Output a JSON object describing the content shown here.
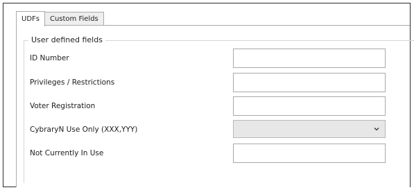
{
  "tabs": [
    {
      "label": "UDFs",
      "active": true
    },
    {
      "label": "Custom Fields",
      "active": false
    }
  ],
  "group": {
    "title": "User defined fields"
  },
  "fields": [
    {
      "label": "ID Number",
      "value": "",
      "type": "text"
    },
    {
      "label": "Privileges / Restrictions",
      "value": "",
      "type": "text"
    },
    {
      "label": "Voter Registration",
      "value": "",
      "type": "text"
    },
    {
      "label": "CybraryN Use Only (XXX,YYY)",
      "value": "",
      "type": "select"
    },
    {
      "label": "Not Currently In Use",
      "value": "",
      "type": "text"
    }
  ],
  "icons": {
    "dropdown": "chevron-down-icon"
  },
  "colors": {
    "border": "#a9a9a9",
    "combo_bg": "#e7e7e7",
    "frame": "#2b2b2b"
  }
}
